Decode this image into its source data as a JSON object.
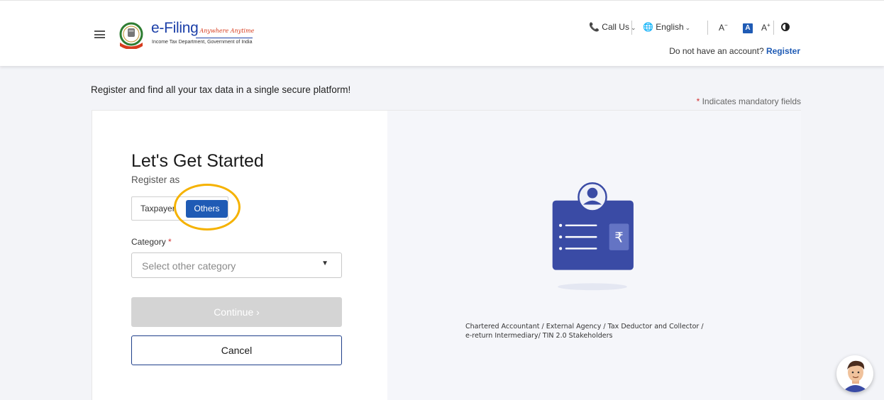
{
  "header": {
    "logo_title": "e-Filing",
    "logo_tagline": "Anywhere Anytime",
    "logo_subtitle": "Income Tax Department, Government of India",
    "call_us": "Call Us",
    "language": "English",
    "font_decrease": "A",
    "font_normal": "A",
    "font_increase": "A",
    "account_prompt": "Do not have an account?",
    "register_link": "Register"
  },
  "page": {
    "tagline": "Register and find all your tax data in a single secure platform!",
    "mandatory_note": "Indicates mandatory fields"
  },
  "form": {
    "title": "Let's Get Started",
    "register_as_label": "Register as",
    "options": [
      "Taxpayer",
      "Others"
    ],
    "selected_option": "Others",
    "category_label": "Category",
    "category_placeholder": "Select other category",
    "continue_label": "Continue",
    "cancel_label": "Cancel"
  },
  "illustration": {
    "caption_line1": "Chartered Accountant / External Agency / Tax Deductor and Collector /",
    "caption_line2": "e-return Intermediary/ TIN 2.0 Stakeholders",
    "currency_glyph": "₹"
  },
  "colors": {
    "primary": "#1f5bb5",
    "brand_blue": "#1b3fa8",
    "illustration_blue": "#3a4ba5",
    "highlight": "#f5b200",
    "mandatory_star": "#d32f2f"
  }
}
